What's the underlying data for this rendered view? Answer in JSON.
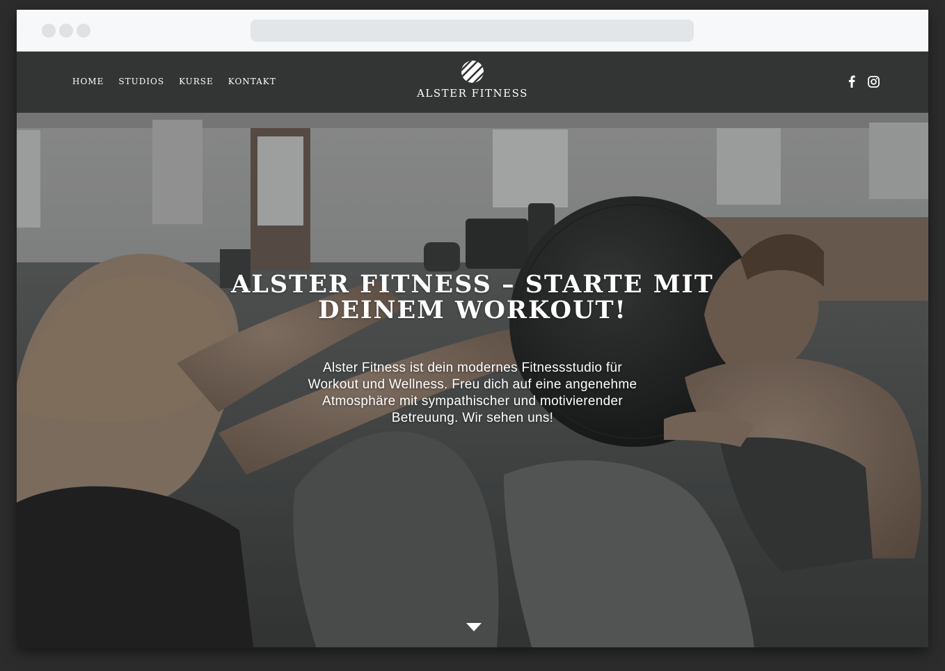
{
  "nav": {
    "items": [
      "HOME",
      "STUDIOS",
      "KURSE",
      "KONTAKT"
    ],
    "brand": "ALSTER FITNESS"
  },
  "social": [
    "facebook-icon",
    "instagram-icon"
  ],
  "hero": {
    "headline": "ALSTER FITNESS – STARTE MIT DEINEM WORKOUT!",
    "text": "Alster Fitness ist dein modernes Fitnessstudio für Workout und Wellness. Freu dich auf eine angenehme Atmosphäre mit sympathischer und motivierender Betreuung. Wir sehen uns!"
  },
  "colors": {
    "nav_background": "#333434",
    "frame_background": "#2c2c2c",
    "text": "#ffffff"
  }
}
